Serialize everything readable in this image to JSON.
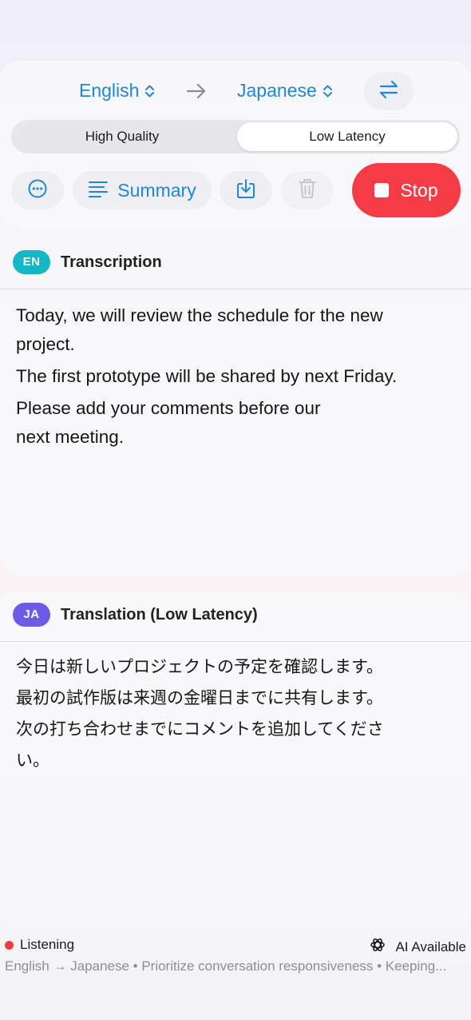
{
  "languages": {
    "source": "English",
    "target": "Japanese"
  },
  "icons": {
    "source_chevron": "chevron-up-down-icon",
    "direction": "arrow-right-icon",
    "swap": "swap-arrows-icon",
    "more": "ellipsis-circle-icon",
    "summary": "text-lines-icon",
    "download": "download-icon",
    "trash": "trash-icon",
    "stop": "stop-square-icon",
    "ai": "ai-sparkle-icon"
  },
  "mode": {
    "options": [
      "High Quality",
      "Low Latency"
    ],
    "selected": "Low Latency"
  },
  "toolbar": {
    "summary_label": "Summary",
    "stop_label": "Stop"
  },
  "transcription": {
    "badge": "EN",
    "title": "Transcription",
    "lines": [
      "Today, we will review the schedule for the new project.",
      "The first prototype will be shared by next Friday.",
      "Please add your comments before our next meeting."
    ]
  },
  "translation": {
    "badge": "JA",
    "title": "Translation (Low Latency)",
    "lines": [
      "今日は新しいプロジェクトの予定を確認します。",
      "最初の試作版は来週の金曜日までに共有します。",
      "次の打ち合わせまでにコメントを追加してください。"
    ]
  },
  "status": {
    "state": "Listening",
    "ai": "AI Available",
    "info": "English → Japanese • Prioritize conversation responsiveness • Keeping..."
  },
  "colors": {
    "accent": "#1f86d9",
    "stop": "#f53c46",
    "en_badge": "#14b8c4",
    "ja_badge": "#6b5be6",
    "listening_dot": "#ef3b3b"
  }
}
